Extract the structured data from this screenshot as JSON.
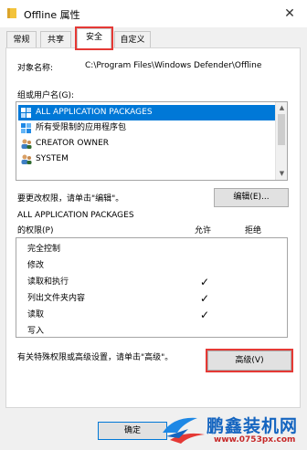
{
  "window": {
    "title": "Offline 属性",
    "close_glyph": "✕"
  },
  "tabs": [
    {
      "label": "常规"
    },
    {
      "label": "共享"
    },
    {
      "label": "安全"
    },
    {
      "label": "自定义"
    }
  ],
  "security": {
    "object_name_label": "对象名称:",
    "object_name_value": "C:\\Program Files\\Windows Defender\\Offline",
    "group_label": "组或用户名(G):",
    "users": [
      {
        "name": "ALL APPLICATION PACKAGES",
        "icon": "package-icon"
      },
      {
        "name": "所有受限制的应用程序包",
        "icon": "package-icon"
      },
      {
        "name": "CREATOR OWNER",
        "icon": "users-icon"
      },
      {
        "name": "SYSTEM",
        "icon": "users-icon"
      }
    ],
    "change_hint": "要更改权限，请单击\"编辑\"。",
    "edit_button": "编辑(E)...",
    "perm_for": "ALL APPLICATION PACKAGES",
    "perm_heading": "的权限(P)",
    "allow_col": "允许",
    "deny_col": "拒绝",
    "permissions": [
      {
        "name": "完全控制",
        "allow": "",
        "deny": ""
      },
      {
        "name": "修改",
        "allow": "",
        "deny": ""
      },
      {
        "name": "读取和执行",
        "allow": "✓",
        "deny": ""
      },
      {
        "name": "列出文件夹内容",
        "allow": "✓",
        "deny": ""
      },
      {
        "name": "读取",
        "allow": "✓",
        "deny": ""
      },
      {
        "name": "写入",
        "allow": "",
        "deny": ""
      }
    ],
    "advanced_hint": "有关特殊权限或高级设置，请单击\"高级\"。",
    "advanced_button": "高级(V)"
  },
  "footer": {
    "ok_button": "确定"
  },
  "watermark": {
    "name": "鹏鑫装机网",
    "url": "www.0753px.com"
  },
  "colors": {
    "selection": "#0078d7",
    "highlight": "#e53935",
    "brand": "#1565c0"
  }
}
